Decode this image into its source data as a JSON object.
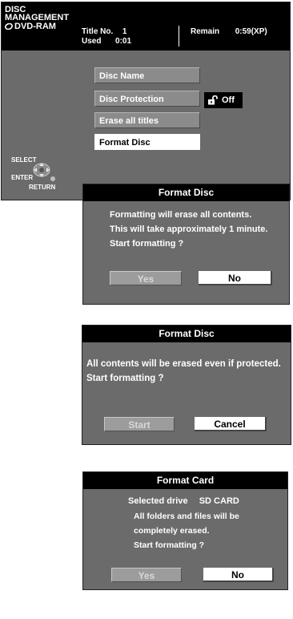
{
  "disc_management": {
    "title_line1": "DISC",
    "title_line2": "MANAGEMENT",
    "title_line3": "DVD-RAM",
    "title_no_label": "Title No.",
    "title_no_value": "1",
    "used_label": "Used",
    "used_value": "0:01",
    "remain_label": "Remain",
    "remain_value": "0:59(XP)",
    "menu": [
      "Disc Name",
      "Disc Protection",
      "Erase all titles",
      "Format Disc"
    ],
    "protection_value": "Off",
    "select_label": "SELECT",
    "enter_label": "ENTER",
    "return_label": "RETURN"
  },
  "dialog_format_disc_1": {
    "title": "Format Disc",
    "lines": [
      "Formatting will erase all contents.",
      "This will take approximately 1 minute.",
      "Start formatting ?"
    ],
    "yes_label": "Yes",
    "no_label": "No"
  },
  "dialog_format_disc_2": {
    "title": "Format Disc",
    "lines": [
      "All contents will be erased even if protected.",
      "Start formatting ?"
    ],
    "start_label": "Start",
    "cancel_label": "Cancel"
  },
  "dialog_format_card": {
    "title": "Format Card",
    "selected_drive_label": "Selected drive",
    "selected_drive_value": "SD CARD",
    "lines": [
      "All folders and files will be",
      "completely erased.",
      "Start formatting ?"
    ],
    "yes_label": "Yes",
    "no_label": "No"
  }
}
